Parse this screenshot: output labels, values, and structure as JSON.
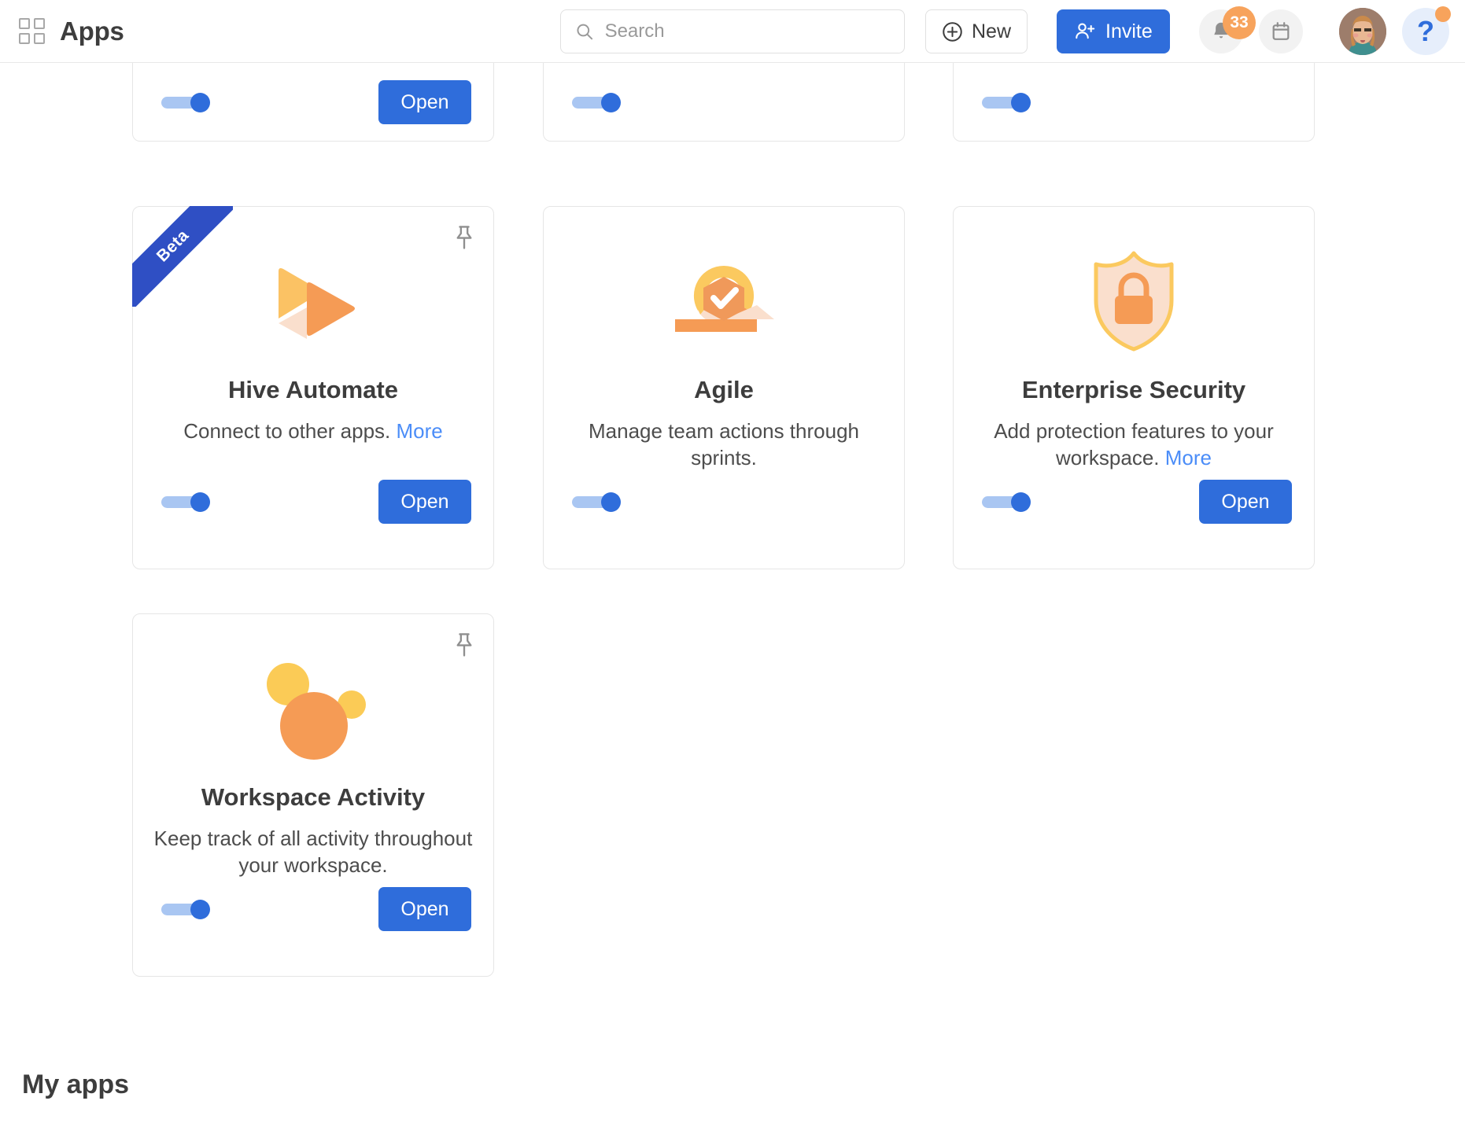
{
  "header": {
    "title": "Apps",
    "grid_icon": "grid-icon",
    "search": {
      "placeholder": "Search",
      "value": "",
      "icon": "search-icon"
    },
    "new_button": {
      "label": "New",
      "icon": "plus-circle-icon"
    },
    "invite_button": {
      "label": "Invite",
      "icon": "person-add-icon",
      "color": "#2f6ddb"
    },
    "notifications": {
      "icon": "bell-icon",
      "badge_count": "33",
      "badge_color": "#f7a35c"
    },
    "calendar": {
      "icon": "calendar-icon"
    },
    "avatar": {
      "icon": "avatar"
    },
    "help": {
      "label": "?",
      "icon": "help-icon",
      "dot_color": "#f7a35c"
    }
  },
  "cards": {
    "partial_row": [
      {
        "toggle_on": true,
        "open_label": "Open",
        "has_open": true
      },
      {
        "toggle_on": true,
        "has_open": false
      },
      {
        "toggle_on": true,
        "has_open": false
      }
    ],
    "hive_automate": {
      "title": "Hive Automate",
      "desc": "Connect to other apps.",
      "more": "More",
      "badge": "Beta",
      "icon": "play-automate-icon",
      "pin_icon": "pin-icon",
      "toggle_on": true,
      "open_label": "Open"
    },
    "agile": {
      "title": "Agile",
      "desc": "Manage team actions through sprints.",
      "icon": "agile-cycle-icon",
      "toggle_on": true
    },
    "enterprise_security": {
      "title": "Enterprise Security",
      "desc": "Add protection features to your workspace.",
      "more": "More",
      "icon": "shield-lock-icon",
      "toggle_on": true,
      "open_label": "Open"
    },
    "workspace_activity": {
      "title": "Workspace Activity",
      "desc": "Keep track of all activity throughout your workspace.",
      "icon": "activity-bubbles-icon",
      "pin_icon": "pin-icon",
      "toggle_on": true,
      "open_label": "Open"
    }
  },
  "sections": {
    "my_apps_heading": "My apps"
  },
  "colors": {
    "accent_blue": "#2f6ddb",
    "link_blue": "#4b8df8",
    "ribbon_blue": "#2f4fc4",
    "orange": "#f59b55",
    "yellow": "#fbc95f",
    "peach": "#fadfcd"
  }
}
